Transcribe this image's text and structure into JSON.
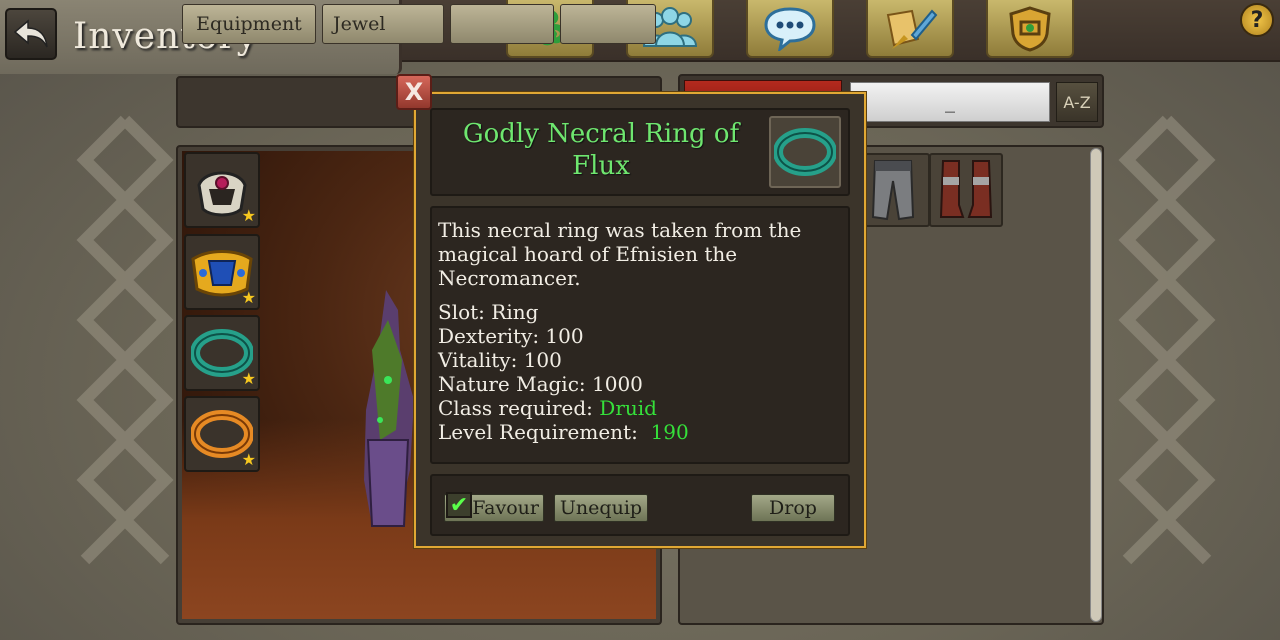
{
  "header": {
    "title": "Inventory",
    "help_label": "?"
  },
  "top_icons": [
    "triskele-icon",
    "players-icon",
    "chat-icon",
    "quest-scroll-icon",
    "guild-shield-icon"
  ],
  "tabs": [
    {
      "label": "Equipment"
    },
    {
      "label": "Jewel"
    },
    {
      "label": ""
    },
    {
      "label": ""
    }
  ],
  "filter": {
    "search_value": "_",
    "sort_label": "A-Z"
  },
  "equip_slots": [
    "necklace-icon",
    "bracer-icon",
    "ring-green-icon",
    "ring-orange-icon"
  ],
  "items": [
    "leg-armor-icon",
    "boots-icon"
  ],
  "popup": {
    "close_label": "X",
    "title": "Godly Necral Ring of Flux",
    "description": "This necral ring was taken from the magical hoard of Efnisien the Necromancer.",
    "stats": [
      {
        "label": "Slot:",
        "value": "Ring"
      },
      {
        "label": "Dexterity:",
        "value": "100"
      },
      {
        "label": "Vitality:",
        "value": "100"
      },
      {
        "label": "Nature Magic:",
        "value": "1000"
      }
    ],
    "class_label": "Class required:",
    "class_value": "Druid",
    "level_label": "Level Requirement:",
    "level_value": "190",
    "favour_label": "Favour",
    "favour_checked": true,
    "unequip_label": "Unequip",
    "drop_label": "Drop"
  },
  "colors": {
    "accent_gold": "#e1a834",
    "title_green": "#6fe66f",
    "highlight_green": "#35e03a"
  }
}
